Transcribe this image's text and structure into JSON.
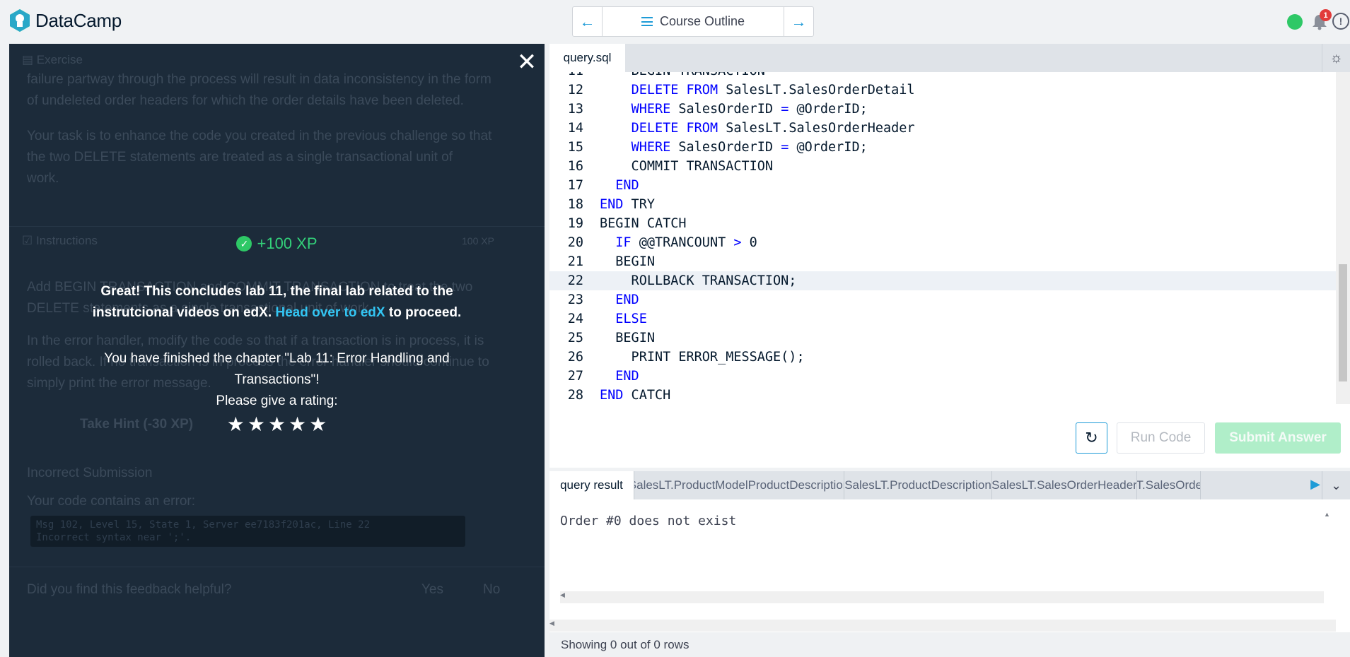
{
  "app": {
    "brand": "DataCamp"
  },
  "nav": {
    "center_label": "Course Outline",
    "notification_count": "1"
  },
  "background": {
    "exercise_header": "Exercise",
    "paragraph1_line1": "failure partway through the process will result in data inconsistency in the form",
    "paragraph1_line2": "of undeleted order headers for which the order details have been deleted.",
    "paragraph2_line1": "Your task is to enhance the code you created in the previous challenge so that",
    "paragraph2_line2": "the two  DELETE  statements are treated as a single transactional unit of",
    "paragraph2_line3": "work.",
    "instructions_header": "Instructions",
    "instructions_xp": "100 XP",
    "instr_line1": "Add  BEGIN TRANSACTION  and  COMMIT TRANSACTION  to treat the two",
    "instr_line2": "DELETE  statements as a single transactional unit of work.",
    "instr_line3": "In the error handler, modify the code so that if a transaction is in process, it is",
    "instr_line4": "rolled back. If no transaction is in process the error handler should continue to",
    "instr_line5": "simply print the error message.",
    "hint_label": "Take Hint (-30 XP)",
    "incorrect_title": "Incorrect Submission",
    "incorrect_text": "Your code contains an error:",
    "error_line1": "Msg 102, Level 15, State 1, Server ee7183f201ac, Line 22",
    "error_line2": "Incorrect syntax near ';'.",
    "feedback_q": "Did you find this feedback helpful?",
    "yes": "Yes",
    "no": "No"
  },
  "modal": {
    "xp": "+100 XP",
    "msg_part1": "Great! This concludes lab 11, the final lab related to the instrutcional videos on edX. ",
    "msg_link": "Head over to edX",
    "msg_part2": " to proceed.",
    "finished": "You have finished the chapter \"Lab 11: Error Handling and Transactions\"!",
    "rating_prompt": "Please give a rating:",
    "stars": 5
  },
  "editor": {
    "tab": "query.sql",
    "lines": [
      {
        "n": "11",
        "tokens": [
          {
            "t": "    BEGIN TRANSACTION",
            "k": false
          }
        ]
      },
      {
        "n": "12",
        "tokens": [
          {
            "t": "    ",
            "k": false
          },
          {
            "t": "DELETE FROM",
            "k": true
          },
          {
            "t": " SalesLT.SalesOrderDetail",
            "k": false
          }
        ]
      },
      {
        "n": "13",
        "tokens": [
          {
            "t": "    ",
            "k": false
          },
          {
            "t": "WHERE",
            "k": true
          },
          {
            "t": " SalesOrderID ",
            "k": false
          },
          {
            "t": "=",
            "k": true
          },
          {
            "t": " @OrderID;",
            "k": false
          }
        ]
      },
      {
        "n": "14",
        "tokens": [
          {
            "t": "    ",
            "k": false
          },
          {
            "t": "DELETE FROM",
            "k": true
          },
          {
            "t": " SalesLT.SalesOrderHeader",
            "k": false
          }
        ]
      },
      {
        "n": "15",
        "tokens": [
          {
            "t": "    ",
            "k": false
          },
          {
            "t": "WHERE",
            "k": true
          },
          {
            "t": " SalesOrderID ",
            "k": false
          },
          {
            "t": "=",
            "k": true
          },
          {
            "t": " @OrderID;",
            "k": false
          }
        ]
      },
      {
        "n": "16",
        "tokens": [
          {
            "t": "    COMMIT TRANSACTION",
            "k": false
          }
        ]
      },
      {
        "n": "17",
        "tokens": [
          {
            "t": "  ",
            "k": false
          },
          {
            "t": "END",
            "k": true
          }
        ]
      },
      {
        "n": "18",
        "tokens": [
          {
            "t": "END",
            "k": true
          },
          {
            "t": " TRY",
            "k": false
          }
        ]
      },
      {
        "n": "19",
        "tokens": [
          {
            "t": "BEGIN CATCH",
            "k": false
          }
        ]
      },
      {
        "n": "20",
        "tokens": [
          {
            "t": "  ",
            "k": false
          },
          {
            "t": "IF",
            "k": true
          },
          {
            "t": " @@TRANCOUNT ",
            "k": false
          },
          {
            "t": ">",
            "k": true
          },
          {
            "t": " 0",
            "k": false
          }
        ]
      },
      {
        "n": "21",
        "tokens": [
          {
            "t": "  BEGIN",
            "k": false
          }
        ]
      },
      {
        "n": "22",
        "tokens": [
          {
            "t": "    ROLLBACK TRANSACTION;",
            "k": false
          }
        ]
      },
      {
        "n": "23",
        "tokens": [
          {
            "t": "  ",
            "k": false
          },
          {
            "t": "END",
            "k": true
          }
        ]
      },
      {
        "n": "24",
        "tokens": [
          {
            "t": "  ",
            "k": false
          },
          {
            "t": "ELSE",
            "k": true
          }
        ]
      },
      {
        "n": "25",
        "tokens": [
          {
            "t": "  BEGIN",
            "k": false
          }
        ]
      },
      {
        "n": "26",
        "tokens": [
          {
            "t": "    PRINT ERROR_MESSAGE();",
            "k": false
          }
        ]
      },
      {
        "n": "27",
        "tokens": [
          {
            "t": "  ",
            "k": false
          },
          {
            "t": "END",
            "k": true
          }
        ]
      },
      {
        "n": "28",
        "tokens": [
          {
            "t": "END",
            "k": true
          },
          {
            "t": " CATCH",
            "k": false
          }
        ]
      }
    ],
    "active_line": "22",
    "run_label": "Run Code",
    "submit_label": "Submit Answer"
  },
  "results": {
    "tabs": [
      "query result",
      "SalesLT.ProductModelProductDescription",
      "SalesLT.ProductDescription",
      "SalesLT.SalesOrderHeader",
      "SalesLT.SalesOrderDetail"
    ],
    "output": "Order #0 does not exist",
    "footer": "Showing 0 out of 0 rows"
  },
  "colors": {
    "accent": "#1e9bd7",
    "success": "#2ec866",
    "keyword": "#0000ff",
    "panel_bg": "#1c2b3a"
  }
}
